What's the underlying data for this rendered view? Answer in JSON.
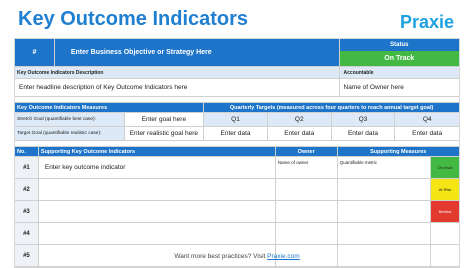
{
  "header": {
    "title": "Key Outcome Indicators",
    "logo": "Praxie"
  },
  "objective": {
    "hash": "#",
    "placeholder": "Enter Business Objective or Strategy Here",
    "status_label": "Status",
    "status_value": "On Track"
  },
  "description": {
    "label": "Key Outcome Indicators Description",
    "accountable_label": "Accountable",
    "text": "Enter headline description of Key Outcome Indicators here",
    "owner": "Name of Owner here"
  },
  "measures": {
    "header": "Key Outcome Indicators Measures",
    "quarterly_header": "Quarterly Targets (measured across four quarters to reach annual target goal)",
    "stretch_label": "Stretch Goal (quantifiable best case):",
    "stretch_goal": "Enter goal here",
    "target_label": "Target Goal (quantifiable realistic case):",
    "target_goal": "Enter realistic goal here",
    "quarters": [
      "Q1",
      "Q2",
      "Q3",
      "Q4"
    ],
    "target_q": [
      "Enter data",
      "Enter data",
      "Enter data",
      "Enter data"
    ]
  },
  "indicators": {
    "col_no": "No.",
    "col_indicators": "Supporting Key Outcome Indicators",
    "col_owner": "Owner",
    "col_measures": "Supporting Measures",
    "rows": [
      {
        "no": "#1",
        "indicator": "Enter key outcome indicator",
        "owner": "Name of owner",
        "metric": "Quantifiable metric",
        "status": "On track"
      },
      {
        "no": "#2",
        "indicator": "",
        "owner": "",
        "metric": "",
        "status": "At Risk"
      },
      {
        "no": "#3",
        "indicator": "",
        "owner": "",
        "metric": "",
        "status": "Behind"
      },
      {
        "no": "#4",
        "indicator": "",
        "owner": "",
        "metric": "",
        "status": ""
      },
      {
        "no": "#5",
        "indicator": "",
        "owner": "",
        "metric": "",
        "status": ""
      }
    ]
  },
  "footer": {
    "text": "Want more best practices? Visit ",
    "link": "Praxie.com"
  },
  "colors": {
    "brand": "#1d74c9",
    "on_track": "#43b843",
    "at_risk": "#f4e514",
    "behind": "#e23a2e"
  }
}
